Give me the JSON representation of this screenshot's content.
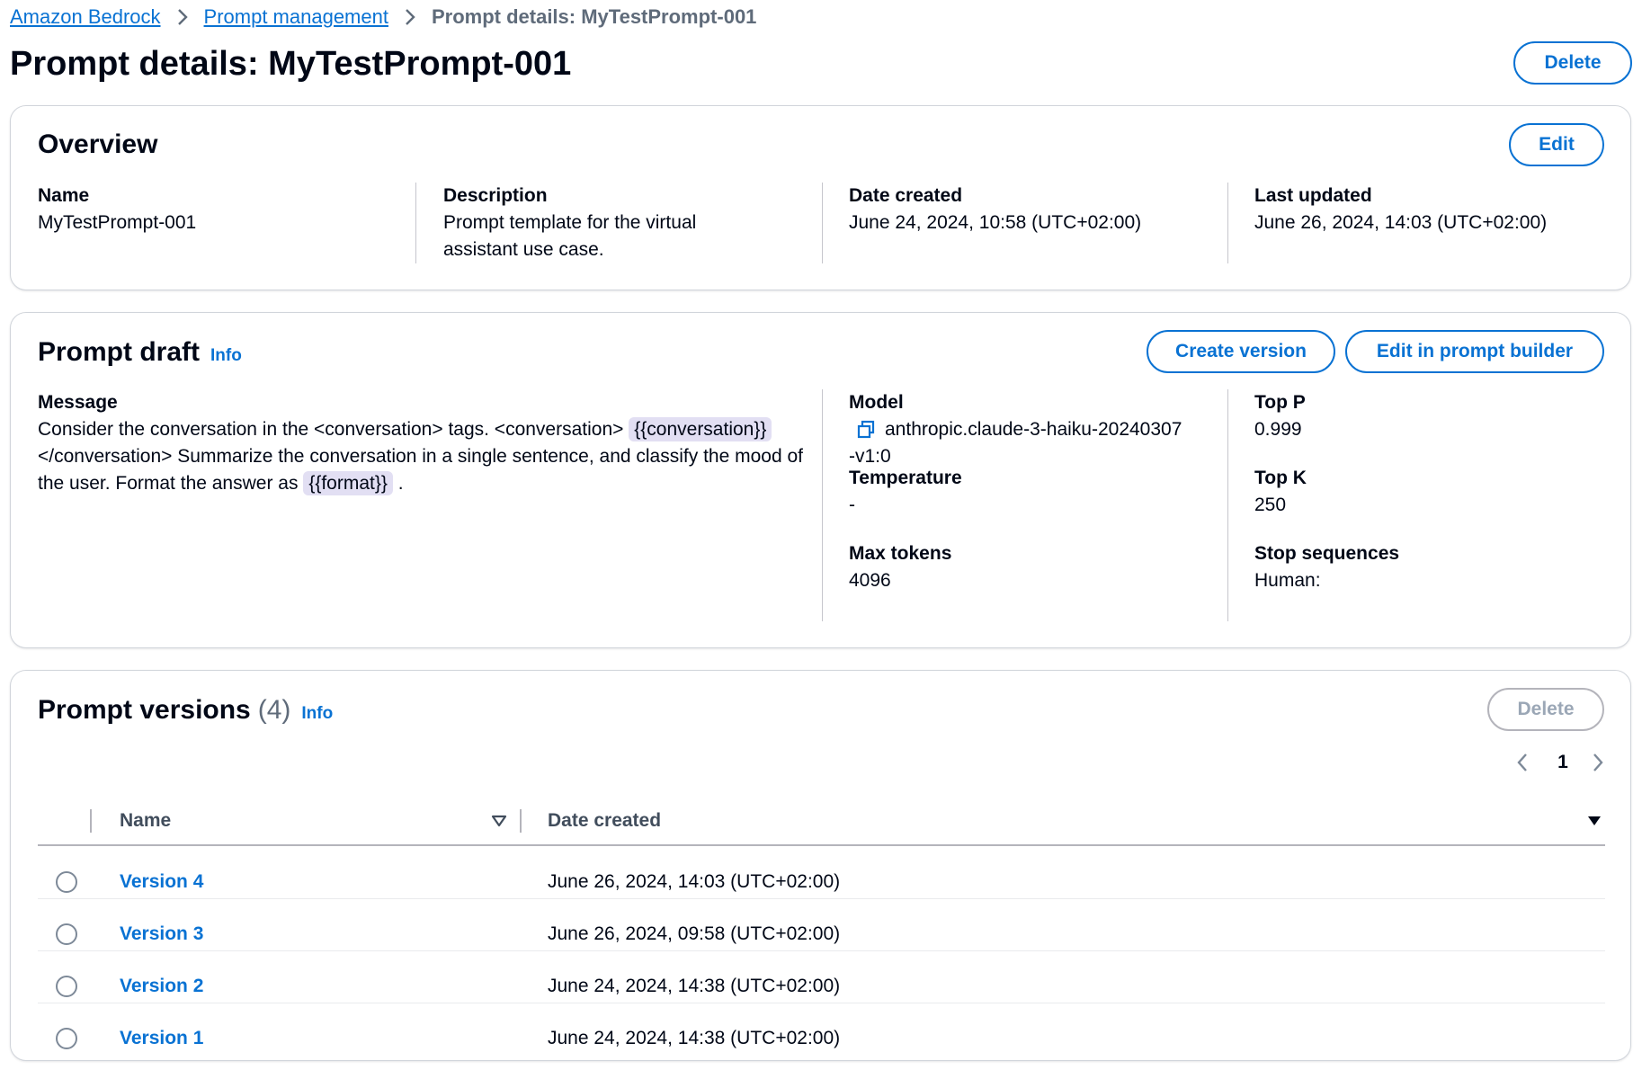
{
  "breadcrumb": {
    "items": [
      "Amazon Bedrock",
      "Prompt management"
    ],
    "current": "Prompt details: MyTestPrompt-001"
  },
  "page": {
    "title": "Prompt details: MyTestPrompt-001",
    "delete_label": "Delete"
  },
  "overview": {
    "title": "Overview",
    "edit_label": "Edit",
    "name_label": "Name",
    "name_value": "MyTestPrompt-001",
    "description_label": "Description",
    "description_value": "Prompt template for the virtual assistant use case.",
    "date_created_label": "Date created",
    "date_created_value": "June 24, 2024, 10:58 (UTC+02:00)",
    "last_updated_label": "Last updated",
    "last_updated_value": "June 26, 2024, 14:03 (UTC+02:00)"
  },
  "draft": {
    "title": "Prompt draft",
    "info_label": "Info",
    "create_version_label": "Create version",
    "edit_builder_label": "Edit in prompt builder",
    "message_label": "Message",
    "message_part1": "Consider the conversation in the <conversation> tags. <conversation>",
    "message_var1": "{{conversation}}",
    "message_part2": "</conversation> Summarize the conversation in a single sentence, and classify the mood of the user. Format the answer as",
    "message_var2": "{{format}}",
    "message_part3": ".",
    "model_label": "Model",
    "model_line1": "anthropic.claude-3-haiku-20240307",
    "model_line2": "-v1:0",
    "temperature_label": "Temperature",
    "temperature_value": "-",
    "max_tokens_label": "Max tokens",
    "max_tokens_value": "4096",
    "top_p_label": "Top P",
    "top_p_value": "0.999",
    "top_k_label": "Top K",
    "top_k_value": "250",
    "stop_sequences_label": "Stop sequences",
    "stop_sequences_value": "Human:"
  },
  "versions": {
    "title": "Prompt versions",
    "count": "(4)",
    "info_label": "Info",
    "delete_label": "Delete",
    "page_number": "1",
    "columns": [
      "Name",
      "Date created"
    ],
    "rows": [
      {
        "name": "Version 4",
        "date": "June 26, 2024, 14:03 (UTC+02:00)"
      },
      {
        "name": "Version 3",
        "date": "June 26, 2024, 09:58 (UTC+02:00)"
      },
      {
        "name": "Version 2",
        "date": "June 24, 2024, 14:38 (UTC+02:00)"
      },
      {
        "name": "Version 1",
        "date": "June 24, 2024, 14:38 (UTC+02:00)"
      }
    ]
  },
  "colors": {
    "link": "#0972d3",
    "text": "#000716",
    "secondary_text": "#5f6b7a",
    "variable_chip": "#e2dff3",
    "border": "#d1d5db",
    "disabled": "#9ba7b6"
  },
  "icons": [
    "chevron-right-icon",
    "copy-icon",
    "sort-caret-down-icon",
    "sort-triangle-down-icon",
    "chevron-left-icon"
  ]
}
